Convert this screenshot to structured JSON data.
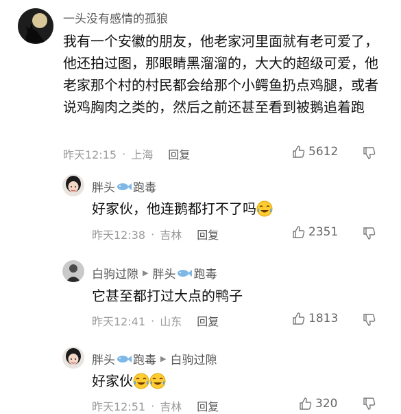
{
  "comments": [
    {
      "user": "一头没有感情的孤狼",
      "text": "我有一个安徽的朋友，他老家河里面就有老可爱了，他还拍过图，那眼睛黑溜溜的，大大的超级可爱，他老家那个村的村民都会给那个小鳄鱼扔点鸡腿，或者说鸡胸肉之类的，然后之前还甚至看到被鹅追着跑",
      "time": "昨天12:15",
      "location": "上海",
      "reply_label": "回复",
      "likes": "5612",
      "avatar_icon": "wolf-avatar"
    }
  ],
  "replies": [
    {
      "user": "胖头",
      "user_suffix": "跑毒",
      "reply_to": "",
      "reply_to_suffix": "",
      "text": "好家伙，他连鹅都打不了吗",
      "time": "昨天12:38",
      "location": "吉林",
      "reply_label": "回复",
      "likes": "2351",
      "emoji": [
        "crying-laughing-emoji"
      ]
    },
    {
      "user": "白驹过隙",
      "user_suffix": "",
      "reply_to": "胖头",
      "reply_to_suffix": "跑毒",
      "text": "它甚至都打过大点的鸭子",
      "time": "昨天12:41",
      "location": "山东",
      "reply_label": "回复",
      "likes": "1813",
      "emoji": []
    },
    {
      "user": "胖头",
      "user_suffix": "跑毒",
      "reply_to": "白驹过隙",
      "reply_to_suffix": "",
      "text": "好家伙",
      "time": "昨天12:51",
      "location": "吉林",
      "reply_label": "回复",
      "likes": "320",
      "emoji": [
        "crying-laughing-emoji",
        "crying-laughing-emoji"
      ]
    }
  ],
  "colors": {
    "meta": "#9a9a9a",
    "name": "#555555",
    "text": "#111111",
    "fish": "#7fb8e6"
  }
}
